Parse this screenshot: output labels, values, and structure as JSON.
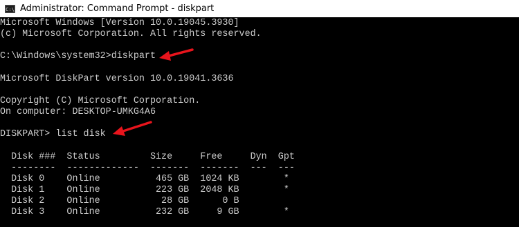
{
  "window": {
    "title": "Administrator: Command Prompt - diskpart",
    "icon": "command-prompt-icon",
    "icon_text": "C:\\"
  },
  "console": {
    "lines": [
      "Microsoft Windows [Version 10.0.19045.3930]",
      "(c) Microsoft Corporation. All rights reserved.",
      "",
      "C:\\Windows\\system32>diskpart",
      "",
      "Microsoft DiskPart version 10.0.19041.3636",
      "",
      "Copyright (C) Microsoft Corporation.",
      "On computer: DESKTOP-UMKG4A6",
      "",
      "DISKPART> list disk",
      "",
      "  Disk ###  Status         Size     Free     Dyn  Gpt",
      "  --------  -------------  -------  -------  ---  ---",
      "  Disk 0    Online          465 GB  1024 KB        *",
      "  Disk 1    Online          223 GB  2048 KB        *",
      "  Disk 2    Online           28 GB      0 B",
      "  Disk 3    Online          232 GB     9 GB        *"
    ]
  },
  "colors": {
    "console_bg": "#000000",
    "console_text": "#cccccc",
    "titlebar_bg": "#ffffff",
    "annotation_arrow": "#e8141c"
  }
}
